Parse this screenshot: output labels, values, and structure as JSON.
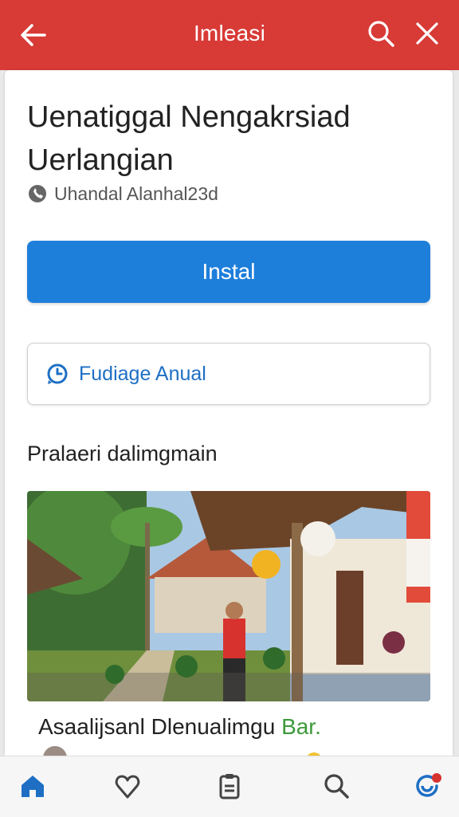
{
  "app_bar": {
    "title": "Imleasi",
    "color": "#d83a36",
    "icons": [
      "back-arrow-icon",
      "search-icon",
      "close-icon"
    ]
  },
  "listing": {
    "title": "Uenatiggal Nengakrsiad Uerlangian",
    "subtitle": "Uhandal Alanhal23d",
    "subtitle_icon": "location-icon",
    "install_label": "Instal",
    "install_color": "#1e7fdb",
    "secondary_label": "Fudiage Anual",
    "secondary_icon": "clock-icon"
  },
  "section": {
    "heading": "Pralaeri dalimgmain",
    "photo_icon": "village-photo",
    "caption_main": "Asaalijsanl Dlenualimgu",
    "caption_highlight": "Bar."
  },
  "bottom_nav": {
    "items": [
      "home-icon",
      "heart-icon",
      "clipboard-icon",
      "search-icon",
      "profile-icon"
    ],
    "active": "home-icon",
    "active_color": "#1e6fc4"
  }
}
